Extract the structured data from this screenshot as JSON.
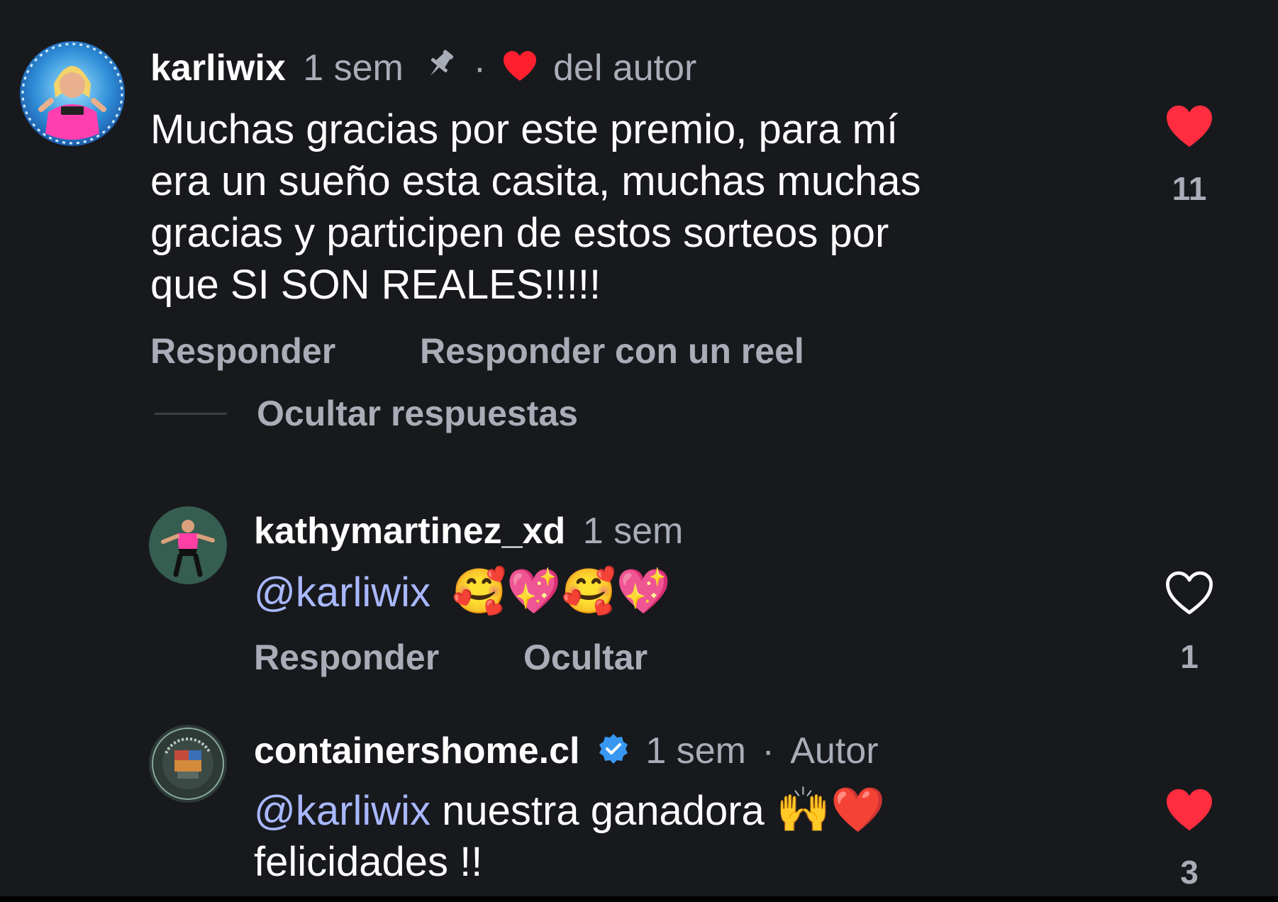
{
  "colors": {
    "background": "#17191d",
    "text_primary": "#ffffff",
    "text_secondary": "#a8adb7",
    "mention": "#a9b8ff",
    "like_active": "#ff2d3f",
    "verified_badge": "#3897f0"
  },
  "comments": [
    {
      "username": "karliwix",
      "time": "1 sem",
      "pinned_icon": "pin-icon",
      "separator": "·",
      "author_like_icon": "heart-icon",
      "author_like_label": "del autor",
      "text_lines": [
        "Muchas gracias por este premio, para mí",
        "era un sueño esta casita, muchas muchas",
        "gracias y participen de estos sorteos por",
        "que SI SON REALES!!!!!"
      ],
      "actions": {
        "reply": "Responder",
        "reply_reel": "Responder con un reel"
      },
      "hide_replies": "Ocultar respuestas",
      "liked": true,
      "like_count": "11"
    },
    {
      "username": "kathymartinez_xd",
      "time": "1 sem",
      "mention": "@karliwix",
      "emojis": "🥰💖🥰💖",
      "actions": {
        "reply": "Responder",
        "hide": "Ocultar"
      },
      "liked": false,
      "like_count": "1"
    },
    {
      "username": "containershome.cl",
      "verified_icon": "verified-badge-icon",
      "time": "1 sem",
      "separator": "·",
      "author_label": "Autor",
      "mention": "@karliwix",
      "text_line1": "nuestra ganadora",
      "emojis": "🙌❤️",
      "text_line2": "felicidades !!",
      "liked": true,
      "like_count": "3"
    }
  ]
}
